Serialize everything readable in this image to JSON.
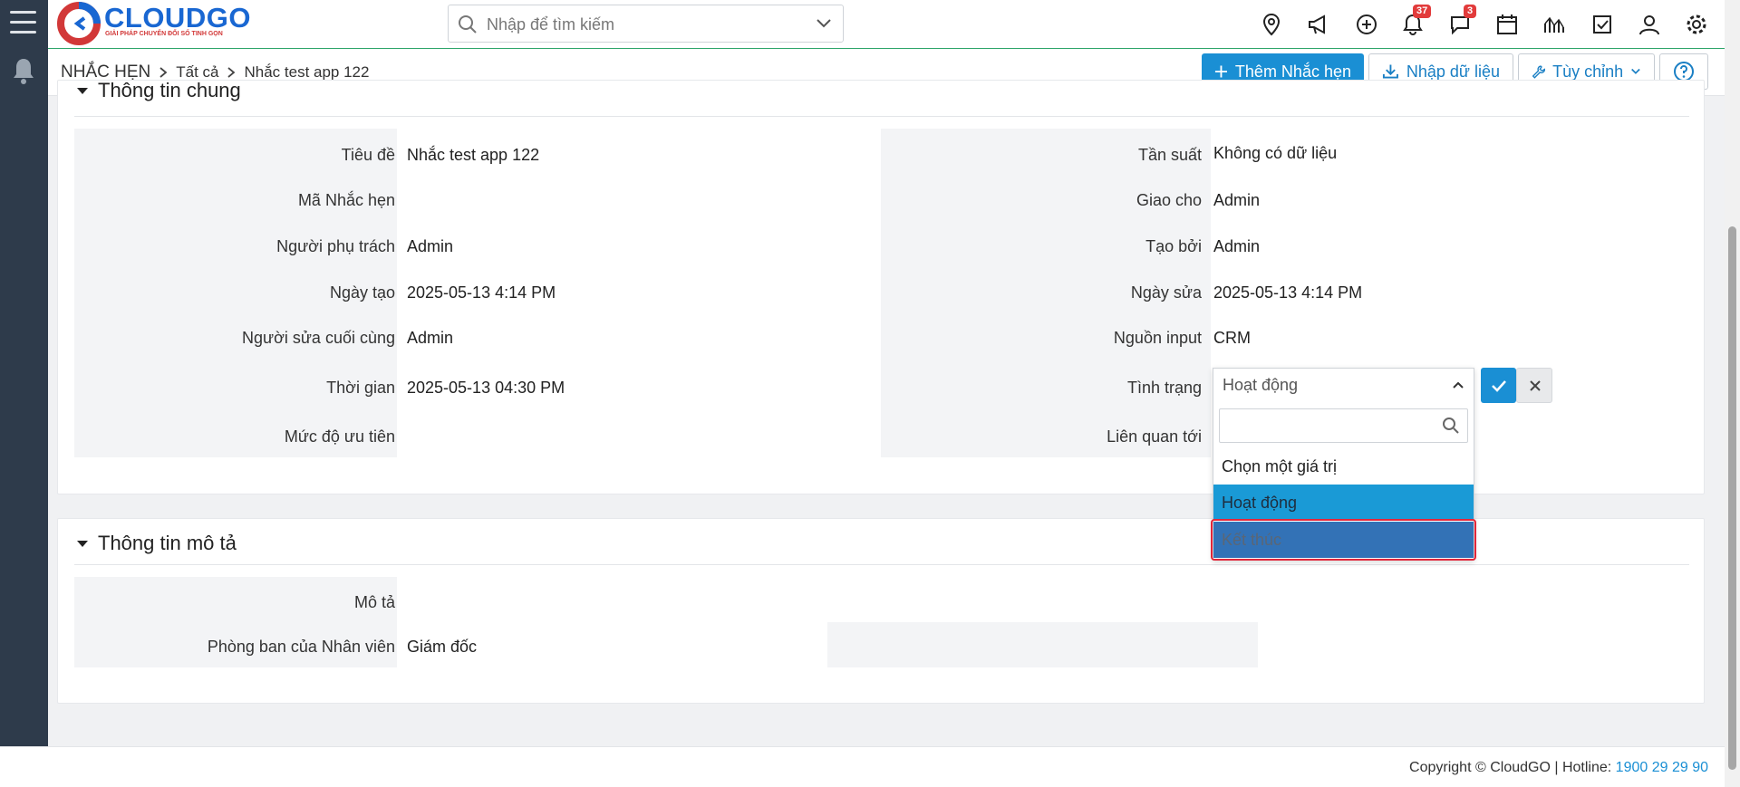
{
  "app": {
    "logo_text": "CLOUDGO",
    "logo_sub": "GIẢI PHÁP CHUYỂN ĐỔI SỐ TINH GỌN"
  },
  "search": {
    "placeholder": "Nhập để tìm kiếm"
  },
  "toolbar": {
    "icons": [
      "location-icon",
      "megaphone-icon",
      "add-circle-icon",
      "bell-icon",
      "chat-icon",
      "calendar-icon",
      "chart-icon",
      "checkbox-icon",
      "user-icon",
      "gear-icon"
    ],
    "notifications_count": "37",
    "messages_count": "3"
  },
  "breadcrumb": {
    "module": "NHẮC HẸN",
    "filter": "Tất cả",
    "record": "Nhắc test app 122"
  },
  "actions": {
    "add_label": "Thêm Nhắc hẹn",
    "import_label": "Nhập dữ liệu",
    "customize_label": "Tùy chỉnh"
  },
  "section1": {
    "title": "Thông tin chung",
    "left": [
      {
        "label": "Tiêu đề",
        "value": "Nhắc test app 122"
      },
      {
        "label": "Mã Nhắc hẹn",
        "value": ""
      },
      {
        "label": "Người phụ trách",
        "value": "Admin"
      },
      {
        "label": "Ngày tạo",
        "value": "2025-05-13 4:14 PM"
      },
      {
        "label": "Người sửa cuối cùng",
        "value": "Admin"
      },
      {
        "label": "Thời gian",
        "value": "2025-05-13 04:30 PM"
      },
      {
        "label": "Mức độ ưu tiên",
        "value": ""
      }
    ],
    "right": [
      {
        "label": "Tần suất",
        "value": "Không có dữ liệu"
      },
      {
        "label": "Giao cho",
        "value": "Admin"
      },
      {
        "label": "Tạo bởi",
        "value": "Admin"
      },
      {
        "label": "Ngày sửa",
        "value": "2025-05-13 4:14 PM"
      },
      {
        "label": "Nguồn input",
        "value": "CRM"
      },
      {
        "label": "Tình trạng",
        "value": ""
      },
      {
        "label": "Liên quan tới",
        "value": ""
      }
    ]
  },
  "status_dropdown": {
    "selected": "Hoạt động",
    "options": [
      "Chọn một giá trị",
      "Hoạt động",
      "Kết thúc"
    ]
  },
  "section2": {
    "title": "Thông tin mô tả",
    "rows": [
      {
        "label": "Mô tả",
        "value": ""
      },
      {
        "label": "Phòng ban của Nhân viên",
        "value": "Giám đốc"
      }
    ]
  },
  "footer": {
    "copyright": "Copyright © CloudGO",
    "hotline_label": "Hotline:",
    "hotline": "1900 29 29 90"
  },
  "colors": {
    "primary": "#1a8fd4",
    "sidebar": "#2e3b4b",
    "highlight_border": "#e2263a",
    "selected_option": "#1a9ad6",
    "hover_option": "#3372b6"
  }
}
